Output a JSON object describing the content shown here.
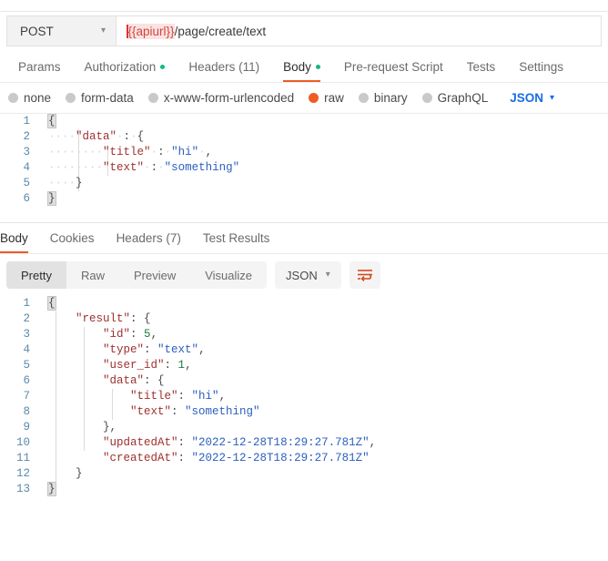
{
  "request": {
    "method": "POST",
    "method_chevron_icon": "chevron-down-icon",
    "url_variable": "{{apiurl}}",
    "url_path": "/page/create/text",
    "tabs": [
      {
        "label": "Params",
        "dot": false,
        "active": false
      },
      {
        "label": "Authorization",
        "dot": true,
        "active": false
      },
      {
        "label": "Headers (11)",
        "dot": false,
        "active": false
      },
      {
        "label": "Body",
        "dot": true,
        "active": true
      },
      {
        "label": "Pre-request Script",
        "dot": false,
        "active": false
      },
      {
        "label": "Tests",
        "dot": false,
        "active": false
      },
      {
        "label": "Settings",
        "dot": false,
        "active": false
      }
    ],
    "body_types": [
      {
        "label": "none",
        "selected": false
      },
      {
        "label": "form-data",
        "selected": false
      },
      {
        "label": "x-www-form-urlencoded",
        "selected": false
      },
      {
        "label": "raw",
        "selected": true
      },
      {
        "label": "binary",
        "selected": false
      },
      {
        "label": "GraphQL",
        "selected": false
      }
    ],
    "format_select": "JSON",
    "format_chevron_icon": "chevron-down-icon",
    "body_lines": [
      {
        "num": "1",
        "text": "{"
      },
      {
        "num": "2",
        "text": "    \"data\" : {"
      },
      {
        "num": "3",
        "text": "        \"title\" : \"hi\" ,"
      },
      {
        "num": "4",
        "text": "        \"text\" : \"something\""
      },
      {
        "num": "5",
        "text": "    }"
      },
      {
        "num": "6",
        "text": "}"
      }
    ]
  },
  "response": {
    "tabs": [
      {
        "label": "Body",
        "active": true
      },
      {
        "label": "Cookies",
        "active": false
      },
      {
        "label": "Headers (7)",
        "active": false
      },
      {
        "label": "Test Results",
        "active": false
      }
    ],
    "view_modes": [
      {
        "label": "Pretty",
        "active": true
      },
      {
        "label": "Raw",
        "active": false
      },
      {
        "label": "Preview",
        "active": false
      },
      {
        "label": "Visualize",
        "active": false
      }
    ],
    "format_select": "JSON",
    "format_chevron_icon": "chevron-down-icon",
    "wrap_button_icon": "word-wrap-icon",
    "body_lines": [
      {
        "num": "1",
        "text": "{"
      },
      {
        "num": "2",
        "text": "    \"result\": {"
      },
      {
        "num": "3",
        "text": "        \"id\": 5,"
      },
      {
        "num": "4",
        "text": "        \"type\": \"text\","
      },
      {
        "num": "5",
        "text": "        \"user_id\": 1,"
      },
      {
        "num": "6",
        "text": "        \"data\": {"
      },
      {
        "num": "7",
        "text": "            \"title\": \"hi\","
      },
      {
        "num": "8",
        "text": "            \"text\": \"something\""
      },
      {
        "num": "9",
        "text": "        },"
      },
      {
        "num": "10",
        "text": "        \"updatedAt\": \"2022-12-28T18:29:27.781Z\","
      },
      {
        "num": "11",
        "text": "        \"createdAt\": \"2022-12-28T18:29:27.781Z\""
      },
      {
        "num": "12",
        "text": "    }"
      },
      {
        "num": "13",
        "text": "}"
      }
    ]
  },
  "colors": {
    "accent_orange": "#ef5b25",
    "accent_blue": "#1a6ce7",
    "status_green": "#12b886",
    "variable_red": "#d4453b",
    "json_key": "#a03030",
    "json_string": "#2b5fbd",
    "json_number": "#1d7a46",
    "line_number": "#5c8aa8"
  }
}
